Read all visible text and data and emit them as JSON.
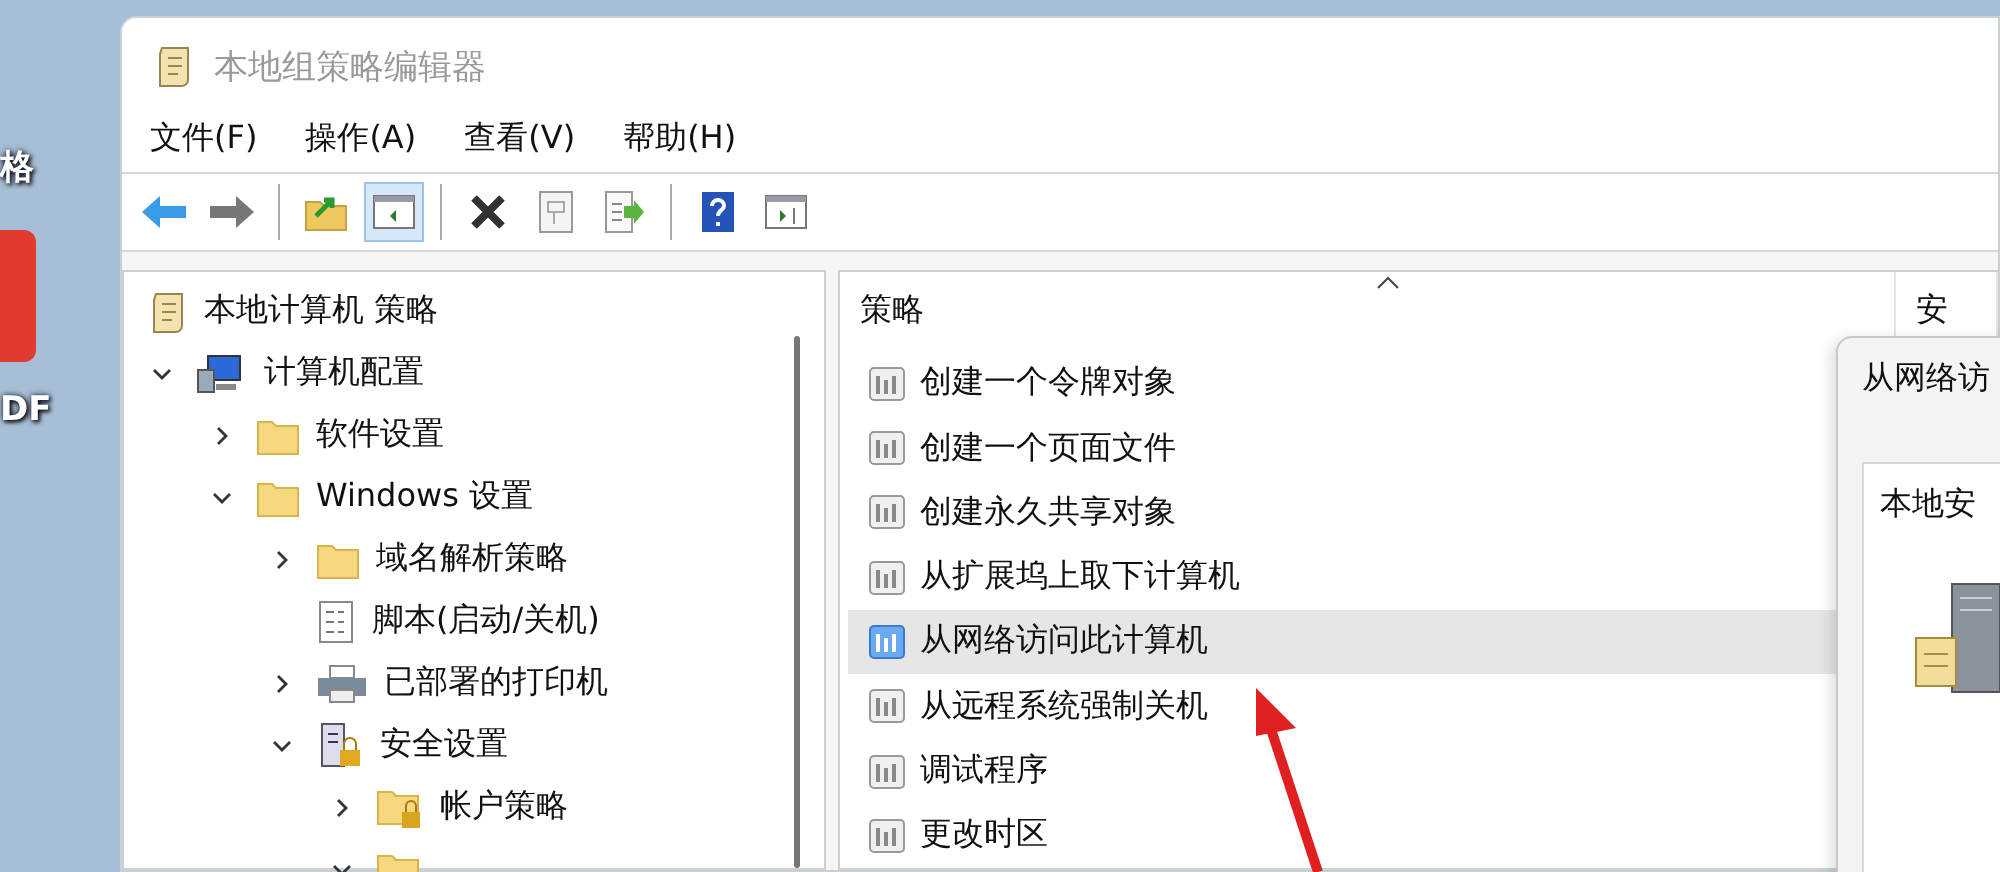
{
  "desktop": {
    "icons": [
      {
        "label": "格",
        "kind": "blank"
      },
      {
        "label": "DF",
        "kind": "red"
      }
    ]
  },
  "window": {
    "title": "本地组策略编辑器"
  },
  "menu": [
    "文件(F)",
    "操作(A)",
    "查看(V)",
    "帮助(H)"
  ],
  "toolbar": [
    {
      "kind": "back",
      "pressed": false
    },
    {
      "kind": "forward",
      "pressed": false
    },
    {
      "kind": "separator"
    },
    {
      "kind": "up",
      "pressed": false
    },
    {
      "kind": "tree",
      "pressed": true
    },
    {
      "kind": "separator"
    },
    {
      "kind": "delete",
      "pressed": false
    },
    {
      "kind": "properties",
      "pressed": false
    },
    {
      "kind": "export",
      "pressed": false
    },
    {
      "kind": "separator"
    },
    {
      "kind": "help",
      "pressed": false
    },
    {
      "kind": "panel",
      "pressed": false
    }
  ],
  "tree": [
    {
      "label": "本地计算机 策略",
      "kind": "root",
      "children": [
        {
          "label": "计算机配置",
          "kind": "computer",
          "expanded": true,
          "children": [
            {
              "label": "软件设置",
              "kind": "folder",
              "expanded": false
            },
            {
              "label": "Windows 设置",
              "kind": "folder",
              "expanded": true,
              "children": [
                {
                  "label": "域名解析策略",
                  "kind": "folder",
                  "expanded": false
                },
                {
                  "label": "脚本(启动/关机)",
                  "kind": "script"
                },
                {
                  "label": "已部署的打印机",
                  "kind": "printer",
                  "expanded": false
                },
                {
                  "label": "安全设置",
                  "kind": "security",
                  "expanded": true,
                  "children": [
                    {
                      "label": "帐户策略",
                      "kind": "lockfolder",
                      "expanded": false
                    },
                    {
                      "kind": "folder",
                      "expanded": true
                    }
                  ]
                }
              ]
            }
          ]
        }
      ]
    }
  ],
  "list": {
    "columns": [
      "策略",
      "安"
    ],
    "rows": [
      {
        "name": "创建一个令牌对象",
        "selected": false
      },
      {
        "name": "创建一个页面文件",
        "selected": false
      },
      {
        "name": "创建永久共享对象",
        "selected": false
      },
      {
        "name": "从扩展坞上取下计算机",
        "selected": false
      },
      {
        "name": "从网络访问此计算机",
        "selected": true
      },
      {
        "name": "从远程系统强制关机",
        "selected": false
      },
      {
        "name": "调试程序",
        "selected": false
      },
      {
        "name": "更改时区",
        "selected": false
      }
    ]
  },
  "dialog": {
    "title": "从网络访",
    "tab": "本地安"
  }
}
